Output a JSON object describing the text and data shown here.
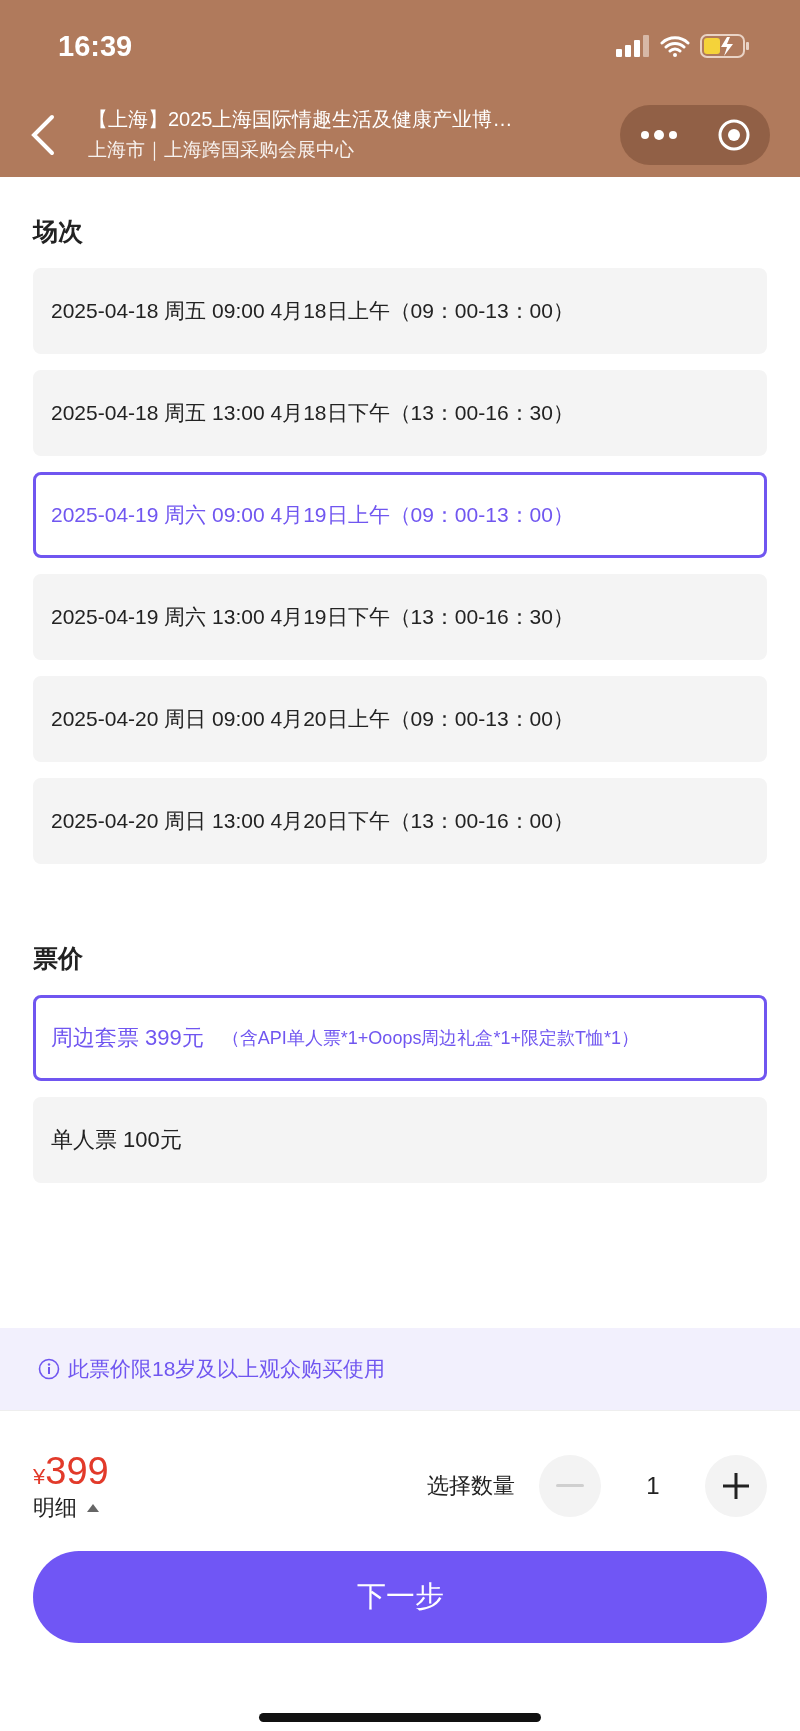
{
  "status_bar": {
    "time": "16:39"
  },
  "nav": {
    "title": "【上海】2025上海国际情趣生活及健康产业博…",
    "subtitle": "上海市｜上海跨国采购会展中心"
  },
  "sessions": {
    "heading": "场次",
    "items": [
      {
        "label": "2025-04-18 周五 09:00 4月18日上午（09：00-13：00）",
        "selected": false
      },
      {
        "label": "2025-04-18 周五 13:00 4月18日下午（13：00-16：30）",
        "selected": false
      },
      {
        "label": "2025-04-19 周六 09:00 4月19日上午（09：00-13：00）",
        "selected": true
      },
      {
        "label": "2025-04-19 周六 13:00 4月19日下午（13：00-16：30）",
        "selected": false
      },
      {
        "label": "2025-04-20 周日 09:00 4月20日上午（09：00-13：00）",
        "selected": false
      },
      {
        "label": "2025-04-20 周日 13:00 4月20日下午（13：00-16：00）",
        "selected": false
      }
    ]
  },
  "tickets": {
    "heading": "票价",
    "items": [
      {
        "label": "周边套票 399元",
        "note": "（含API单人票*1+Ooops周边礼盒*1+限定款T恤*1）",
        "selected": true
      },
      {
        "label": "单人票 100元",
        "selected": false
      }
    ]
  },
  "notice": "此票价限18岁及以上观众购买使用",
  "footer": {
    "currency": "¥",
    "price": "399",
    "details": "明细",
    "quantity_label": "选择数量",
    "quantity": "1",
    "decrease_disabled": true,
    "increase_disabled": false,
    "next_button": "下一步"
  }
}
